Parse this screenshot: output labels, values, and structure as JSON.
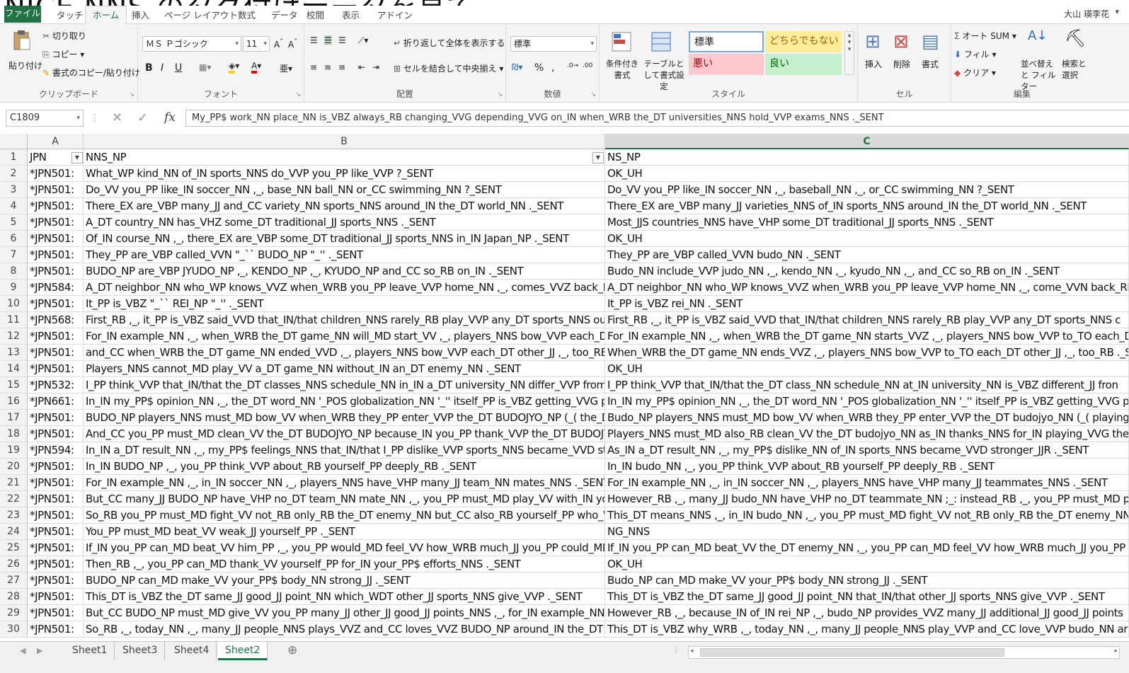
{
  "window": {
    "title_fragment": "NICE NNS のタグ付けデータを見て。",
    "user": "大山 瑛李花"
  },
  "tabs": {
    "file": "ファイル",
    "items": [
      "タッチ",
      "ホーム",
      "挿入",
      "ページ レイアウト",
      "数式",
      "データ",
      "校閲",
      "表示",
      "アドイン"
    ],
    "active": "ホーム"
  },
  "ribbon": {
    "clipboard": {
      "label": "クリップボード",
      "paste": "貼り付け",
      "cut": "切り取り",
      "copy": "コピー",
      "format_painter": "書式のコピー/貼り付け"
    },
    "font": {
      "label": "フォント",
      "name": "ＭＳ Ｐゴシック",
      "size": "11",
      "bold": "B",
      "italic": "I",
      "underline": "U"
    },
    "alignment": {
      "label": "配置",
      "wrap": "折り返して全体を表示する",
      "merge": "セルを結合して中央揃え"
    },
    "number": {
      "label": "数値",
      "format": "標準",
      "percent": "%",
      "comma": ","
    },
    "styles": {
      "label": "スタイル",
      "cond_format": "条件付き書式",
      "table_format": "テーブルとして書式設定",
      "normal": "標準",
      "neutral": "どちらでもない",
      "bad": "悪い",
      "good": "良い"
    },
    "cells": {
      "label": "セル",
      "insert": "挿入",
      "delete": "削除",
      "format": "書式"
    },
    "editing": {
      "label": "編集",
      "autosum": "オート SUM",
      "fill": "フィル",
      "clear": "クリア",
      "sort_filter": "並べ替えと フィルター",
      "find_select": "検索と 選択"
    }
  },
  "formula_bar": {
    "name_box": "C1809",
    "fx": "fx",
    "formula": "My_PP$ work_NN place_NN is_VBZ always_RB changing_VVG depending_VVG on_IN when_WRB the_DT universities_NNS hold_VVP exams_NNS ._SENT"
  },
  "columns": [
    "A",
    "B",
    "C"
  ],
  "selected_column": "C",
  "rows": [
    {
      "n": "1",
      "a": "JPN",
      "b": "NNS_NP",
      "c": "NS_NP"
    },
    {
      "n": "2",
      "a": "*JPN501:",
      "b": "What_WP kind_NN of_IN sports_NNS do_VVP you_PP like_VVP ?_SENT",
      "c": "OK_UH"
    },
    {
      "n": "3",
      "a": "*JPN501:",
      "b": "Do_VV you_PP like_IN soccer_NN ,_, base_NN ball_NN or_CC swimming_NN ?_SENT",
      "c": "Do_VV you_PP like_IN soccer_NN ,_, baseball_NN ,_, or_CC swimming_NN ?_SENT"
    },
    {
      "n": "4",
      "a": "*JPN501:",
      "b": "There_EX are_VBP many_JJ and_CC variety_NN sports_NNS around_IN the_DT world_NN ._SENT",
      "c": "There_EX are_VBP many_JJ varieties_NNS of_IN sports_NNS around_IN the_DT world_NN ._SENT"
    },
    {
      "n": "5",
      "a": "*JPN501:",
      "b": "A_DT country_NN has_VHZ some_DT traditional_JJ sports_NNS ._SENT",
      "c": "Most_JJS countries_NNS have_VHP some_DT traditional_JJ sports_NNS ._SENT"
    },
    {
      "n": "6",
      "a": "*JPN501:",
      "b": "Of_IN course_NN ,_, there_EX are_VBP some_DT traditional_JJ sports_NNS in_IN Japan_NP ._SENT",
      "c": "OK_UH"
    },
    {
      "n": "7",
      "a": "*JPN501:",
      "b": "They_PP are_VBP called_VVN \"_`` BUDO_NP \"_'' ._SENT",
      "c": "They_PP are_VBP called_VVN budo_NN ._SENT"
    },
    {
      "n": "8",
      "a": "*JPN501:",
      "b": "BUDO_NP are_VBP JYUDO_NP ,_, KENDO_NP ,_, KYUDO_NP and_CC so_RB on_IN ._SENT",
      "c": "Budo_NN include_VVP judo_NN ,_, kendo_NN ,_, kyudo_NN ,_, and_CC so_RB on_IN ._SENT"
    },
    {
      "n": "9",
      "a": "*JPN584:",
      "b": "A_DT neighbor_NN who_WP knows_VVZ when_WRB you_PP leave_VVP home_NN ,_, comes_VVZ back_RB ,_, c",
      "c": "A_DT neighbor_NN who_WP knows_VVZ when_WRB you_PP leave_VVP home_NN ,_, come_VVN back_RB"
    },
    {
      "n": "10",
      "a": "*JPN501:",
      "b": "It_PP is_VBZ \"_`` REI_NP \"_'' ._SENT",
      "c": "It_PP is_VBZ rei_NN ._SENT"
    },
    {
      "n": "11",
      "a": "*JPN568:",
      "b": "First_RB ,_, it_PP is_VBZ said_VVD that_IN/that children_NNS rarely_RB play_VVP any_DT sports_NNS outsi",
      "c": "First_RB ,_, it_PP is_VBZ said_VVD that_IN/that children_NNS rarely_RB play_VVP any_DT sports_NNS c"
    },
    {
      "n": "12",
      "a": "*JPN501:",
      "b": "For_IN example_NN ,_, when_WRB the_DT game_NN will_MD start_VV ,_, players_NNS bow_VVP each_DT othe",
      "c": "For_IN example_NN ,_, when_WRB the_DT game_NN starts_VVZ ,_, players_NNS bow_VVP to_TO each_DT"
    },
    {
      "n": "13",
      "a": "*JPN501:",
      "b": "and_CC when_WRB the_DT game_NN ended_VVD ,_, players_NNS bow_VVP each_DT other_JJ ,_, too_RB ._SE",
      "c": "When_WRB the_DT game_NN ends_VVZ ,_, players_NNS bow_VVP to_TO each_DT other_JJ ,_, too_RB ._S"
    },
    {
      "n": "14",
      "a": "*JPN501:",
      "b": "Players_NNS cannot_MD play_VV a_DT game_NN without_IN an_DT enemy_NN ._SENT",
      "c": "OK_UH"
    },
    {
      "n": "15",
      "a": "*JPN532:",
      "b": "I_PP think_VVP that_IN/that the_DT classes_NNS schedule_NN in_IN a_DT university_NN differ_VVP from_IN",
      "c": "I_PP think_VVP that_IN/that the_DT class_NN schedule_NN at_IN university_NN is_VBZ different_JJ fron"
    },
    {
      "n": "16",
      "a": "*JPN661:",
      "b": "In_IN my_PP$ opinion_NN ,_, the_DT word_NN '_POS globalization_NN '_'' itself_PP is_VBZ getting_VVG prevale",
      "c": "In_IN my_PP$ opinion_NN ,_, the_DT word_NN '_POS globalization_NN '_'' itself_PP is_VBZ getting_VVG pre"
    },
    {
      "n": "17",
      "a": "*JPN501:",
      "b": "BUDO_NP players_NNS must_MD bow_VV when_WRB they_PP enter_VVP the_DT BUDOJYO_NP (_( the_DT",
      "c": "Budo_NP players_NNS must_MD bow_VV when_WRB they_PP enter_VVP the_DT budojyo_NN (_( playing_"
    },
    {
      "n": "18",
      "a": "*JPN501:",
      "b": "And_CC you_PP must_MD clean_VV the_DT BUDOJYO_NP because_IN you_PP thank_VVP the_DT BUDOJY",
      "c": "Players_NNS must_MD also_RB clean_VV the_DT budojyo_NN as_IN thanks_NNS for_IN playing_VVG ther"
    },
    {
      "n": "19",
      "a": "*JPN594:",
      "b": "In_IN a_DT result_NN ,_, my_PP$ feelings_NNS that_IN/that I_PP dislike_VVP sports_NNS became_VVD stron",
      "c": "As_IN a_DT result_NN ,_, my_PP$ dislike_NN of_IN sports_NNS became_VVD stronger_JJR ._SENT"
    },
    {
      "n": "20",
      "a": "*JPN501:",
      "b": "In_IN BUDO_NP ,_, you_PP think_VVP about_RB yourself_PP deeply_RB ._SENT",
      "c": "In_IN budo_NN ,_, you_PP think_VVP about_RB yourself_PP deeply_RB ._SENT"
    },
    {
      "n": "21",
      "a": "*JPN501:",
      "b": "For_IN example_NN ,_, in_IN soccer_NN ,_, players_NNS have_VHP many_JJ team_NN mates_NNS ._SENT",
      "c": "For_IN example_NN ,_, in_IN soccer_NN ,_, players_NNS have_VHP many_JJ teammates_NNS ._SENT"
    },
    {
      "n": "22",
      "a": "*JPN501:",
      "b": "But_CC many_JJ BUDO_NP have_VHP no_DT team_NN mate_NN ,_, you_PP must_MD play_VV with_IN yours",
      "c": "However_RB ,_, many_JJ budo_NN have_VHP no_DT teammate_NN ;_: instead_RB ,_, you_PP must_MD pl"
    },
    {
      "n": "23",
      "a": "*JPN501:",
      "b": "So_RB you_PP must_MD fight_VV not_RB only_RB the_DT enemy_NN but_CC also_RB yourself_PP who_WP f",
      "c": "This_DT means_NNS ,_, in_IN budo_NN ,_, you_PP must_MD fight_VV not_RB only_RB the_DT enemy_NN b"
    },
    {
      "n": "24",
      "a": "*JPN501:",
      "b": "You_PP must_MD beat_VV weak_JJ yourself_PP ._SENT",
      "c": "NG_NNS"
    },
    {
      "n": "25",
      "a": "*JPN501:",
      "b": "If_IN you_PP can_MD beat_VV him_PP ,_, you_PP would_MD feel_VV how_WRB much_JJ you_PP could_MD gro",
      "c": "If_IN you_PP can_MD beat_VV the_DT enemy_NN ,_, you_PP can_MD feel_VV how_WRB much_JJ you_PP"
    },
    {
      "n": "26",
      "a": "*JPN501:",
      "b": "Then_RB ,_, you_PP can_MD thank_VV yourself_PP for_IN your_PP$ efforts_NNS ._SENT",
      "c": "OK_UH"
    },
    {
      "n": "27",
      "a": "*JPN501:",
      "b": "BUDO_NP can_MD make_VV your_PP$ body_NN strong_JJ ._SENT",
      "c": "Budo_NP can_MD make_VV your_PP$ body_NN strong_JJ ._SENT"
    },
    {
      "n": "28",
      "a": "*JPN501:",
      "b": "This_DT is_VBZ the_DT same_JJ good_JJ point_NN which_WDT other_JJ sports_NNS give_VVP ._SENT",
      "c": "This_DT is_VBZ the_DT same_JJ good_JJ point_NN that_IN/that other_JJ sports_NNS give_VVP ._SENT"
    },
    {
      "n": "29",
      "a": "*JPN501:",
      "b": "But_CC BUDO_NP must_MD give_VV you_PP many_JJ other_JJ good_JJ points_NNS ,_, for_IN example_NN ,",
      "c": "However_RB ,_, because_IN of_IN rei_NP ,_, budo_NP provides_VVZ many_JJ additional_JJ good_JJ points"
    },
    {
      "n": "30",
      "a": "*JPN501:",
      "b": "So_RB ,_, today_NN ,_, many_JJ people_NNS plays_VVZ and_CC loves_VVZ BUDO_NP around_IN the_DT wor",
      "c": "This_DT is_VBZ why_WRB ,_, today_NN ,_, many_JJ people_NNS play_VVP and_CC love_VVP budo_NN ar"
    }
  ],
  "sheets": {
    "tabs": [
      "Sheet1",
      "Sheet3",
      "Sheet4",
      "Sheet2"
    ],
    "active": "Sheet2",
    "add": "⊕"
  }
}
